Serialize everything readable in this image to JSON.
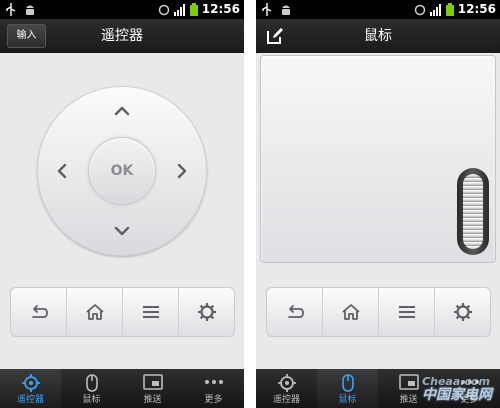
{
  "status_bar": {
    "time": "12:56"
  },
  "remote": {
    "title": "遥控器",
    "input_button_label": "输入",
    "ok_label": "OK"
  },
  "mouse": {
    "title": "鼠标"
  },
  "tabs": [
    {
      "label": "遥控器",
      "icon": "crosshair-icon"
    },
    {
      "label": "鼠标",
      "icon": "mouse-icon"
    },
    {
      "label": "推送",
      "icon": "cast-icon"
    },
    {
      "label": "更多",
      "icon": "more-dots-icon"
    }
  ],
  "watermark": "中国家电网",
  "colors": {
    "active_tab": "#3da2f1",
    "bar": "#1a1a1b"
  }
}
